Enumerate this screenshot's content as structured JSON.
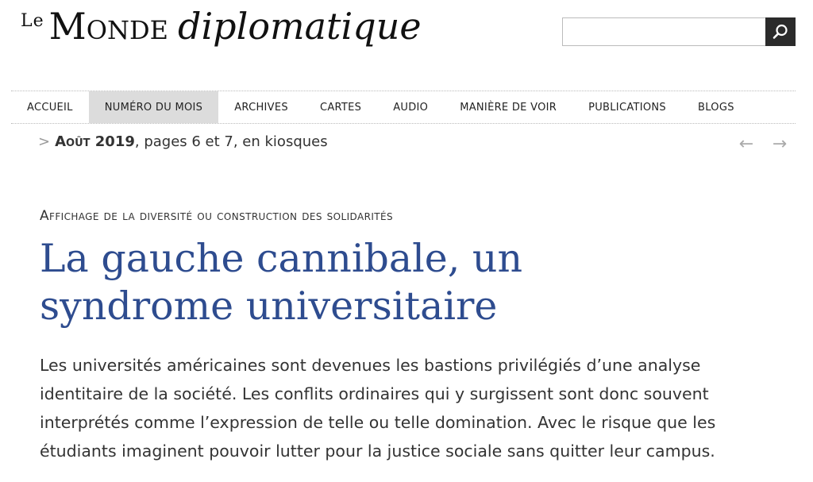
{
  "header": {
    "logo": {
      "le": "Le",
      "monde": "Monde",
      "diplomatique": "diplomatique"
    },
    "search": {
      "value": "",
      "placeholder": "",
      "button_icon": "search-icon"
    }
  },
  "nav": {
    "items": [
      {
        "label": "ACCUEIL",
        "active": false
      },
      {
        "label": "NUMÉRO DU MOIS",
        "active": true
      },
      {
        "label": "ARCHIVES",
        "active": false
      },
      {
        "label": "CARTES",
        "active": false
      },
      {
        "label": "AUDIO",
        "active": false
      },
      {
        "label": "MANIÈRE DE VOIR",
        "active": false
      },
      {
        "label": "PUBLICATIONS",
        "active": false
      },
      {
        "label": "BLOGS",
        "active": false
      }
    ]
  },
  "issue": {
    "chevron": ">",
    "date": "Août 2019",
    "rest": ", pages 6 et 7, en kiosques",
    "prev_icon": "arrow-left-icon",
    "next_icon": "arrow-right-icon"
  },
  "article": {
    "kicker": "Affichage de la diversité ou construction des solidarités",
    "title": "La gauche cannibale, un syndrome universitaire",
    "chapo": "Les universités américaines sont devenues les bastions privilégiés d’une analyse identitaire de la société. Les conflits ordinaires qui y surgissent sont donc souvent interprétés comme l’expression de telle ou telle domination. Avec le risque que les étudiants imaginent pouvoir lutter pour la justice sociale sans quitter leur campus."
  },
  "colors": {
    "title": "#2e4c8f",
    "nav_active_bg": "#dcdcdc",
    "search_button": "#2b2b2b"
  }
}
